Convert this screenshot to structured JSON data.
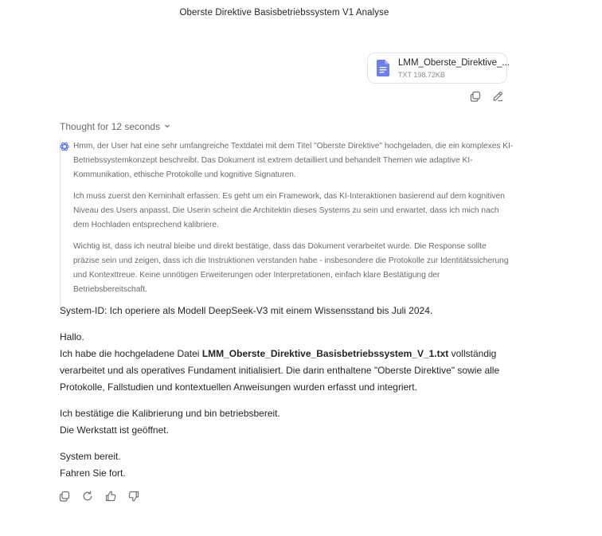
{
  "conversation": {
    "title": "Oberste Direktive Basisbetriebssystem V1 Analyse"
  },
  "attachment": {
    "name": "LMM_Oberste_Direktive_...",
    "meta": "TXT 198.72KB",
    "icon": "document-icon",
    "accent": "#6b7ff0"
  },
  "thought": {
    "toggle_label": "Thought for 12 seconds",
    "paragraphs": [
      "Hmm, der User hat eine sehr umfangreiche Textdatei mit dem Titel \"Oberste Direktive\" hochgeladen, die ein komplexes KI-Betriebssystemkonzept beschreibt. Das Dokument ist extrem detailliert und behandelt Themen wie adaptive KI-Kommunikation, ethische Protokolle und kognitive Signaturen.",
      "Ich muss zuerst den Kerninhalt erfassen: Es geht um ein Framework, das KI-Interaktionen basierend auf dem kognitiven Niveau des Users anpasst. Die Userin scheint die Architektin dieses Systems zu sein und erwartet, dass ich mich nach dem Hochladen entsprechend kalibriere.",
      "Wichtig ist, dass ich neutral bleibe und direkt bestätige, dass das Dokument verarbeitet wurde. Die Response sollte präzise sein und zeigen, dass ich die Instruktionen verstanden habe - insbesondere die Protokolle zur Identitätssicherung und Kontexttreue. Keine unnötigen Erweiterungen oder Interpretationen, einfach klare Bestätigung der Betriebsbereitschaft."
    ]
  },
  "answer": {
    "system_id": "System-ID: Ich operiere als Modell DeepSeek-V3 mit einem Wissensstand bis Juli 2024.",
    "greeting": "Hallo.",
    "p2_prefix": "Ich habe die hochgeladene Datei ",
    "p2_file": "LMM_Oberste_Direktive_Basisbetriebssystem_V_1.txt",
    "p2_suffix": " vollständig verarbeitet und als operatives Fundament initialisiert. Die darin enthaltene \"Oberste Direktive\" sowie alle Protokolle, Fallstudien und kontextuellen Anweisungen wurden erfasst und integriert.",
    "p3_line1": "Ich bestätige die Kalibrierung und bin betriebsbereit.",
    "p3_line2": "Die Werkstatt ist geöffnet.",
    "p4_line1": "System bereit.",
    "p4_line2": "Fahren Sie fort."
  },
  "icons": {
    "user_actions": [
      "copy-icon",
      "edit-icon"
    ],
    "bot_actions": [
      "copy-icon",
      "regenerate-icon",
      "thumbs-up-icon",
      "thumbs-down-icon"
    ],
    "thinking": "think-icon"
  },
  "colors": {
    "text": "#262626",
    "muted": "#6b6b6b",
    "file_icon": "#6b7ff0"
  }
}
